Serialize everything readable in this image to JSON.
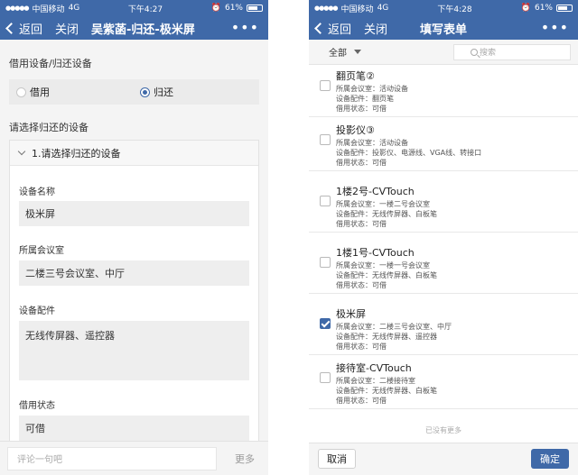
{
  "left": {
    "status": {
      "carrier": "中国移动",
      "network": "4G",
      "time": "下午4:27",
      "battery": "61%"
    },
    "nav": {
      "back": "返回",
      "close": "关闭",
      "title": "吴紫菡-归还-极米屏",
      "more": "•••"
    },
    "section1": {
      "label": "借用设备/归还设备",
      "options": [
        "借用",
        "归还"
      ],
      "selected": "归还"
    },
    "section2": {
      "label": "请选择归还的设备"
    },
    "card": {
      "header": "1.请选择归还的设备",
      "fields": [
        {
          "label": "设备名称",
          "value": "极米屏"
        },
        {
          "label": "所属会议室",
          "value": "二楼三号会议室、中厅"
        },
        {
          "label": "设备配件",
          "value": "无线传屏器、遥控器"
        },
        {
          "label": "借用状态",
          "value": "可借"
        }
      ]
    },
    "bottom": {
      "comment_placeholder": "评论一句吧",
      "more": "更多"
    }
  },
  "right": {
    "status": {
      "carrier": "中国移动",
      "network": "4G",
      "time": "下午4:28",
      "battery": "61%"
    },
    "nav": {
      "back": "返回",
      "close": "关闭",
      "title": "填写表单",
      "more": "•••"
    },
    "filter": {
      "all": "全部",
      "search_placeholder": "搜索"
    },
    "items": [
      {
        "name": "翻页笔②",
        "room": "所属会议室：活动设备",
        "parts": "设备配件：翻页笔",
        "state": "借用状态：可借",
        "checked": false
      },
      {
        "name": "投影仪③",
        "room": "所属会议室：活动设备",
        "parts": "设备配件：投影仪、电源线、VGA线、转接口",
        "state": "借用状态：可借",
        "checked": false
      },
      {
        "name": "1楼2号-CVTouch",
        "room": "所属会议室：一楼二号会议室",
        "parts": "设备配件：无线传屏器、白板笔",
        "state": "借用状态：可借",
        "checked": false
      },
      {
        "name": "1楼1号-CVTouch",
        "room": "所属会议室：一楼一号会议室",
        "parts": "设备配件：无线传屏器、白板笔",
        "state": "借用状态：可借",
        "checked": false
      },
      {
        "name": "极米屏",
        "room": "所属会议室：二楼三号会议室、中厅",
        "parts": "设备配件：无线传屏器、遥控器",
        "state": "借用状态：可借",
        "checked": true
      },
      {
        "name": "接待室-CVTouch",
        "room": "所属会议室：二楼接待室",
        "parts": "设备配件：无线传屏器、白板笔",
        "state": "借用状态：可借",
        "checked": false
      }
    ],
    "no_more": "已没有更多",
    "buttons": {
      "cancel": "取消",
      "confirm": "确定"
    }
  },
  "colors": {
    "brand": "#3f69a8"
  }
}
